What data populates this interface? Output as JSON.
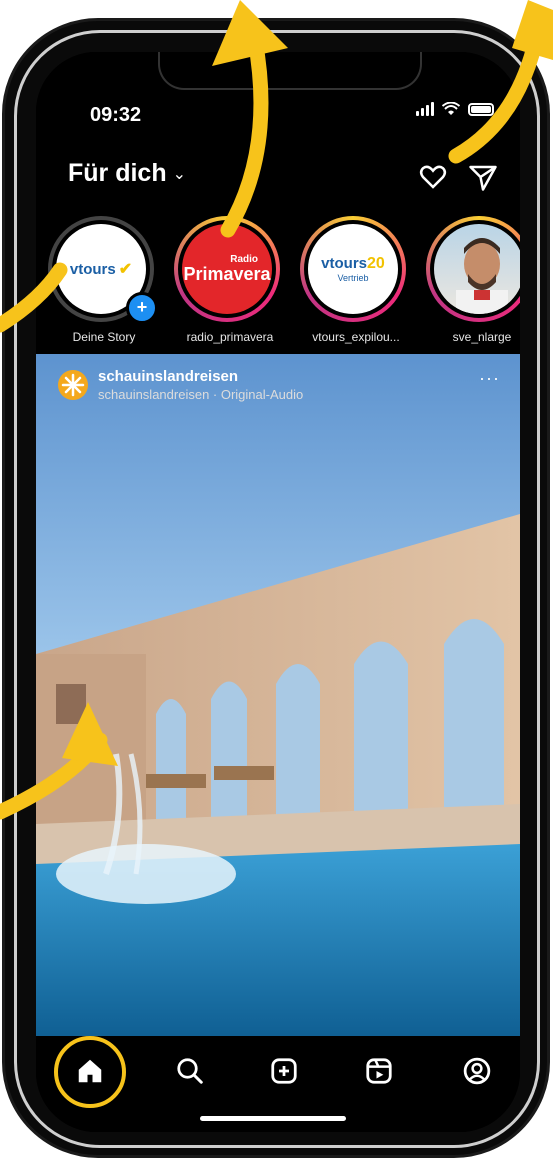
{
  "status": {
    "time": "09:32"
  },
  "header": {
    "title": "Für dich",
    "title_chevron": "⌄",
    "icons": [
      "heart-icon",
      "send-icon"
    ]
  },
  "stories": [
    {
      "label": "Deine Story",
      "logo_text": "vtours",
      "badge": "+"
    },
    {
      "label": "radio_primavera",
      "logo_small": "Radio",
      "logo_big": "Primavera"
    },
    {
      "label": "vtours_expilou...",
      "logo_text": "vtours",
      "logo_num": "20",
      "logo_sub": "Vertrieb"
    },
    {
      "label": "sve_nlarge"
    }
  ],
  "post": {
    "username": "schauinslandreisen",
    "subtitle": "schauinslandreisen · Original-Audio",
    "more": "···"
  },
  "tabbar": {
    "icons": [
      "home-icon",
      "search-icon",
      "add-post-icon",
      "reels-icon",
      "profile-icon"
    ],
    "active": "home"
  },
  "colors": {
    "accent_annotation": "#f7c31b",
    "story_badge": "#1d8ff2",
    "radio_red": "#e3262a",
    "pool": "#2f8fc9"
  }
}
